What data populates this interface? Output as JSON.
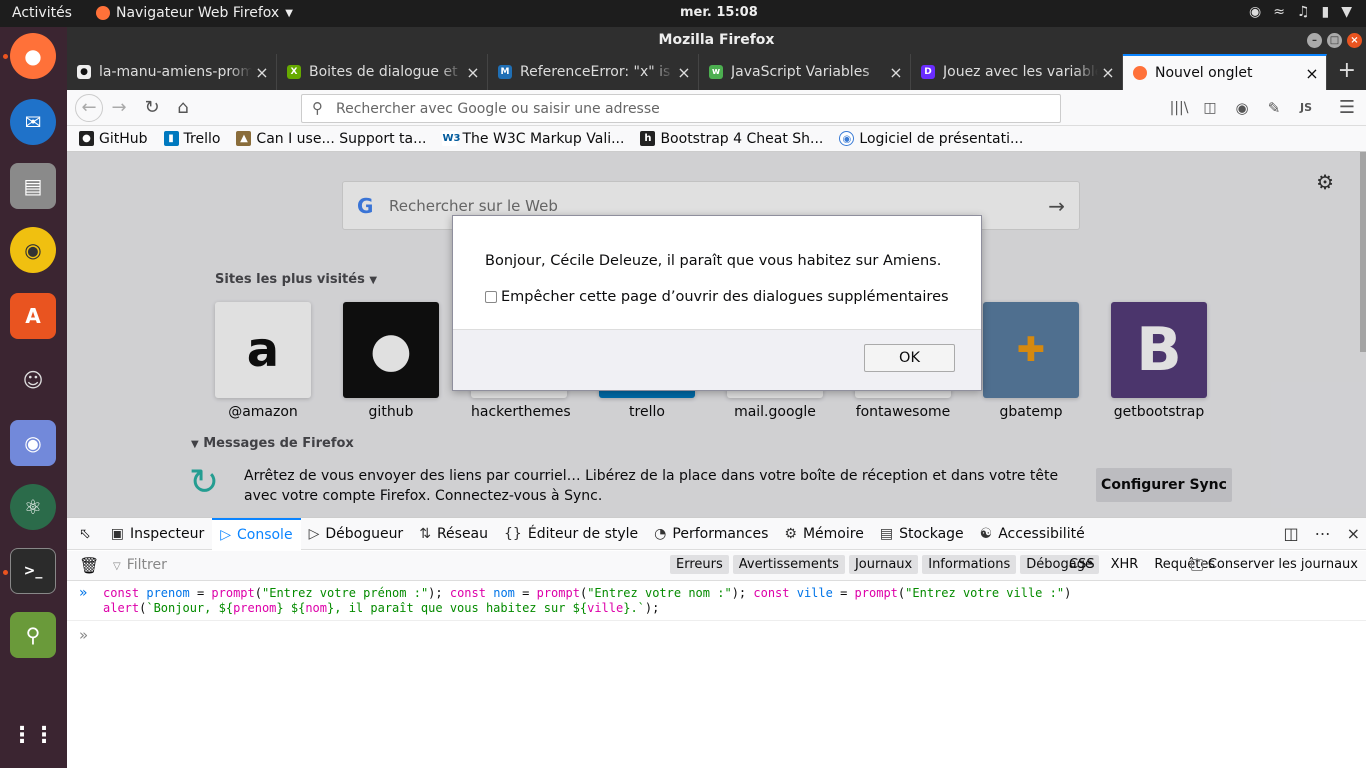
{
  "topbar": {
    "activities": "Activités",
    "app_name": "Navigateur Web Firefox",
    "clock": "mer. 15:08"
  },
  "window": {
    "title": "Mozilla Firefox"
  },
  "tabs": [
    {
      "label": "la-manu-amiens-promo",
      "color": "#333"
    },
    {
      "label": "Boites de dialogue et ne",
      "color": "#6a0"
    },
    {
      "label": "ReferenceError: \"x\" is n",
      "color": "#1f6fb5"
    },
    {
      "label": "JavaScript Variables",
      "color": "#4caf50"
    },
    {
      "label": "Jouez avec les variables",
      "color": "#6a2cff"
    },
    {
      "label": "Nouvel onglet",
      "color": "#ff7139"
    }
  ],
  "navbar": {
    "url_placeholder": "Rechercher avec Google ou saisir une adresse",
    "js_label": "JS"
  },
  "bookmarks": [
    {
      "label": "GitHub",
      "icon": "github-icon",
      "color": "#222"
    },
    {
      "label": "Trello",
      "icon": "trello-icon",
      "color": "#0079bf"
    },
    {
      "label": "Can I use... Support ta...",
      "icon": "caniuse-icon",
      "color": "#8a6d3b"
    },
    {
      "label": "The W3C Markup Vali...",
      "icon": "w3c-icon",
      "color": "#005a9c"
    },
    {
      "label": "Bootstrap 4 Cheat Sh...",
      "icon": "hackerthemes-icon",
      "color": "#222"
    },
    {
      "label": "Logiciel de présentati...",
      "icon": "presentation-icon",
      "color": "#3a7bd5"
    }
  ],
  "newtab": {
    "search_placeholder": "Rechercher sur le Web",
    "top_sites_title": "Sites les plus visités",
    "sites": [
      {
        "name": "@amazon",
        "glyph": "a",
        "bg": "#fff",
        "fg": "#111"
      },
      {
        "name": "github",
        "glyph": "●",
        "bg": "#111",
        "fg": "#fff"
      },
      {
        "name": "hackerthemes",
        "glyph": "",
        "bg": "#fff",
        "fg": "#111"
      },
      {
        "name": "trello",
        "glyph": "",
        "bg": "#0079bf",
        "fg": "#fff"
      },
      {
        "name": "mail.google",
        "glyph": "",
        "bg": "#fff",
        "fg": "#c00"
      },
      {
        "name": "fontawesome",
        "glyph": "",
        "bg": "#fff",
        "fg": "#228ae6"
      },
      {
        "name": "gbatemp",
        "glyph": "",
        "bg": "#5b7fa3",
        "fg": "#fff"
      },
      {
        "name": "getbootstrap",
        "glyph": "B",
        "bg": "#563d7c",
        "fg": "#fff"
      }
    ],
    "messages_title": "Messages de Firefox",
    "message_text": "Arrêtez de vous envoyer des liens par courriel… Libérez de la place dans votre boîte de réception et dans votre tête avec votre compte Firefox. Connectez-vous à Sync.",
    "sync_button": "Configurer Sync"
  },
  "dialog": {
    "message": "Bonjour, Cécile Deleuze, il paraît que vous habitez sur Amiens.",
    "checkbox_label": "Empêcher cette page d’ouvrir des dialogues supplémentaires",
    "ok_label": "OK"
  },
  "devtools": {
    "tabs": [
      {
        "label": "Inspecteur",
        "icon": "▢"
      },
      {
        "label": "Console",
        "icon": "▸"
      },
      {
        "label": "Débogueur",
        "icon": "▷"
      },
      {
        "label": "Réseau",
        "icon": "⇅"
      },
      {
        "label": "Éditeur de style",
        "icon": "{}"
      },
      {
        "label": "Performances",
        "icon": "◔"
      },
      {
        "label": "Mémoire",
        "icon": "⚙"
      },
      {
        "label": "Stockage",
        "icon": "☰"
      },
      {
        "label": "Accessibilité",
        "icon": "♱"
      }
    ],
    "filter_placeholder": "Filtrer",
    "filter_buttons": [
      "Erreurs",
      "Avertissements",
      "Journaux",
      "Informations",
      "Débogage"
    ],
    "filter_buttons2": [
      "CSS",
      "XHR",
      "Requêtes"
    ],
    "keep_logs": "Conserver les journaux"
  }
}
